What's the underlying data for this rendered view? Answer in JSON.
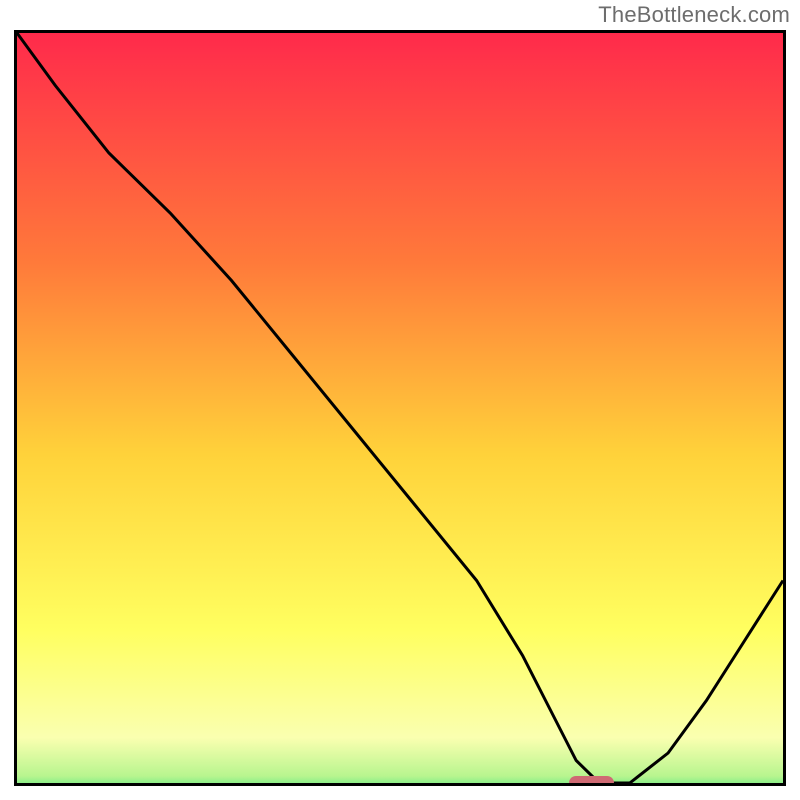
{
  "watermark": "TheBottleneck.com",
  "colors": {
    "gradient_top": "#ff2a4b",
    "gradient_mid1": "#ff7a3a",
    "gradient_mid2": "#ffd23a",
    "gradient_mid3": "#ffff60",
    "gradient_bottom": "#2fe07a",
    "curve": "#000000",
    "marker": "#cf6a73",
    "border": "#000000"
  },
  "chart_data": {
    "type": "line",
    "title": "",
    "xlabel": "",
    "ylabel": "",
    "xlim": [
      0,
      100
    ],
    "ylim": [
      0,
      100
    ],
    "x": [
      0,
      5,
      12,
      20,
      28,
      36,
      44,
      52,
      60,
      66,
      70,
      73,
      76,
      80,
      85,
      90,
      95,
      100
    ],
    "values": [
      100,
      93,
      84,
      76,
      67,
      57,
      47,
      37,
      27,
      17,
      9,
      3,
      0,
      0,
      4,
      11,
      19,
      27
    ],
    "marker": {
      "x": 75,
      "y": 0,
      "width": 6
    },
    "gradient_stops": [
      {
        "offset": 0.0,
        "color": "#ff2a4b"
      },
      {
        "offset": 0.3,
        "color": "#ff7a3a"
      },
      {
        "offset": 0.55,
        "color": "#ffd23a"
      },
      {
        "offset": 0.78,
        "color": "#ffff60"
      },
      {
        "offset": 0.92,
        "color": "#faffb0"
      },
      {
        "offset": 0.97,
        "color": "#b8f58f"
      },
      {
        "offset": 1.0,
        "color": "#2fe07a"
      }
    ]
  }
}
